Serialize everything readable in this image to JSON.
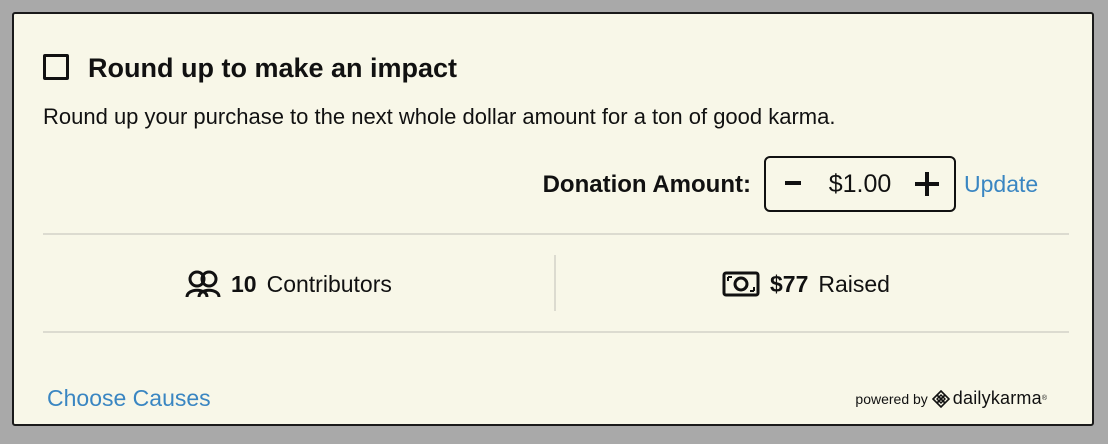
{
  "widget": {
    "title": "Round up to make an impact",
    "checkbox_checked": false,
    "description": "Round up your purchase to the next whole dollar amount for a ton of good karma."
  },
  "donation": {
    "label": "Donation Amount:",
    "decrement_symbol": "-",
    "amount": "$1.00",
    "increment_symbol": "+",
    "update_label": "Update"
  },
  "stats": {
    "contributors_count": "10",
    "contributors_label": "Contributors",
    "contributors_icon": "users-icon",
    "raised_amount": "$77",
    "raised_label": "Raised",
    "raised_icon": "cash-icon"
  },
  "footer": {
    "choose_causes_label": "Choose Causes",
    "powered_by": "powered by",
    "brand": "dailykarma",
    "brand_mark": "®"
  },
  "colors": {
    "background": "#f8f7e8",
    "link": "#3a86c2",
    "border": "#1a1a1a",
    "divider": "#dcdbd0"
  }
}
